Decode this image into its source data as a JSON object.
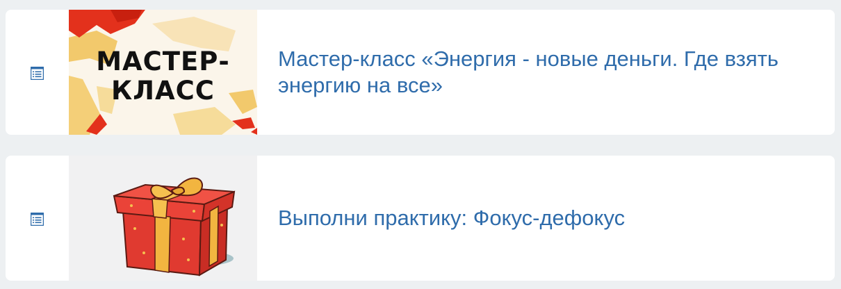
{
  "items": [
    {
      "icon": "document-list-icon",
      "thumbnail_text": [
        "МАСТЕР-",
        "КЛАСС"
      ],
      "title": "Мастер-класс «Энергия - новые деньги. Где взять энергию на все»"
    },
    {
      "icon": "document-list-icon",
      "thumbnail": "gift-box",
      "title": "Выполни практику: Фокус-дефокус"
    }
  ],
  "colors": {
    "background": "#edf0f2",
    "card": "#ffffff",
    "link": "#2f6cab",
    "icon": "#2f6cab"
  }
}
